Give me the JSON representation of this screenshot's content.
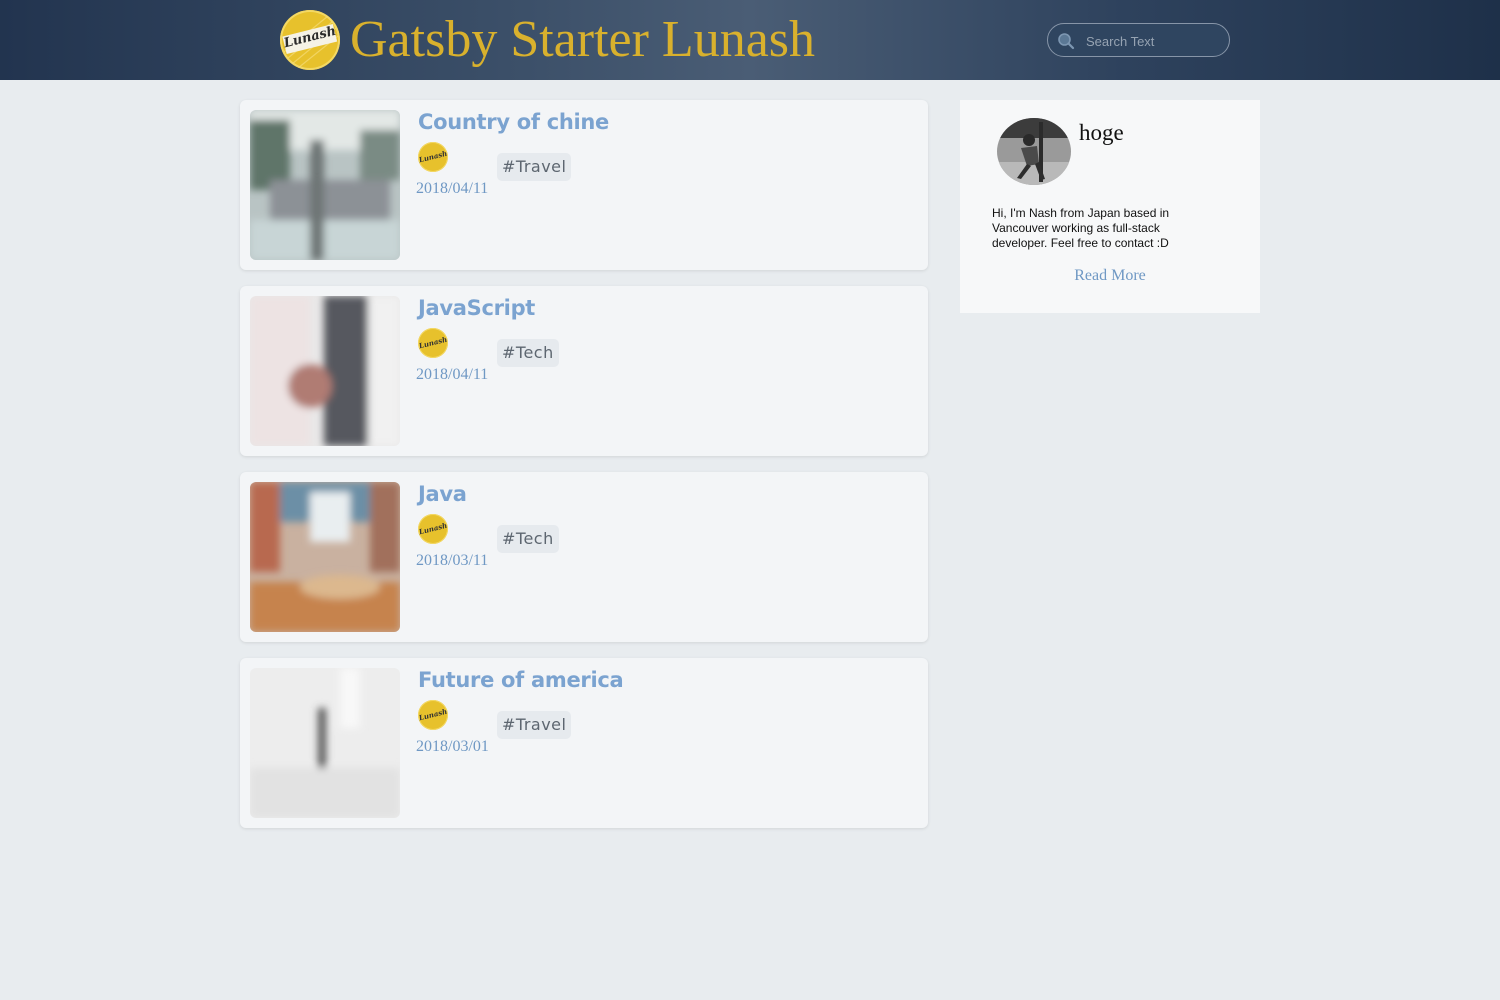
{
  "header": {
    "logo_text": "Lunash",
    "title": "Gatsby Starter Lunash",
    "search": {
      "placeholder": "Search Text",
      "value": ""
    }
  },
  "posts": [
    {
      "title": "Country of chine",
      "date": "2018/04/11",
      "tag": "#Travel",
      "author_logo_text": "Lunash"
    },
    {
      "title": "JavaScript",
      "date": "2018/04/11",
      "tag": "#Tech",
      "author_logo_text": "Lunash"
    },
    {
      "title": "Java",
      "date": "2018/03/11",
      "tag": "#Tech",
      "author_logo_text": "Lunash"
    },
    {
      "title": "Future of america",
      "date": "2018/03/01",
      "tag": "#Travel",
      "author_logo_text": "Lunash"
    }
  ],
  "profile": {
    "name": "hoge",
    "bio": "Hi, I'm Nash from Japan based in Vancouver working as full-stack developer. Feel free to contact :D",
    "read_more": "Read More"
  },
  "colors": {
    "header_bg": "#2f435d",
    "title_gold": "#d9b12d",
    "link_blue": "#7ba3d0",
    "page_bg": "#e8ecef",
    "card_bg": "#f3f5f7"
  }
}
